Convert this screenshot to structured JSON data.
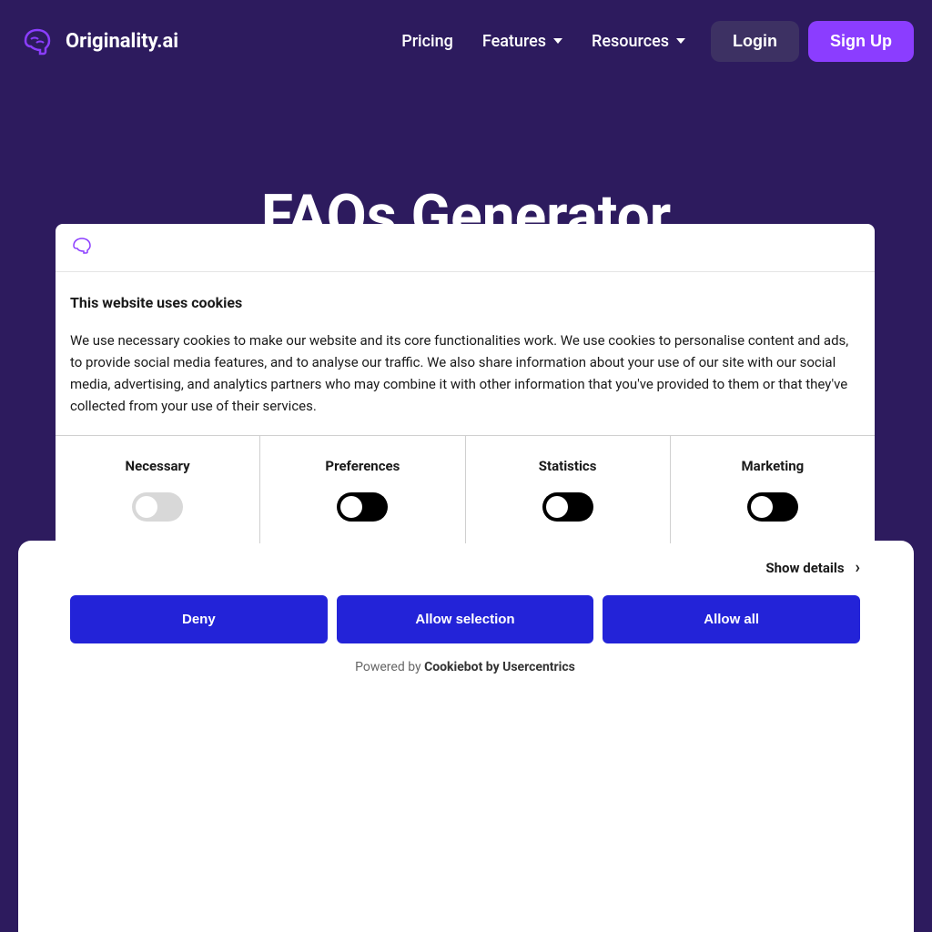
{
  "header": {
    "logo_text": "Originality.ai",
    "nav": {
      "pricing": "Pricing",
      "features": "Features",
      "resources": "Resources"
    },
    "login": "Login",
    "signup": "Sign Up"
  },
  "hero": {
    "title": "FAQs Generator"
  },
  "cookie_modal": {
    "title": "This website uses cookies",
    "description": "We use necessary cookies to make our website and its core functionalities work. We use cookies to personalise content and ads, to provide social media features, and to analyse our traffic. We also share information about your use of our site with our social media, advertising, and analytics partners who may combine it with other information that you've provided to them or that they've collected from your use of their services.",
    "categories": {
      "necessary": "Necessary",
      "preferences": "Preferences",
      "statistics": "Statistics",
      "marketing": "Marketing"
    },
    "show_details": "Show details",
    "buttons": {
      "deny": "Deny",
      "allow_selection": "Allow selection",
      "allow_all": "Allow all"
    },
    "powered_by_prefix": "Powered by ",
    "powered_by_brand": "Cookiebot by Usercentrics"
  }
}
